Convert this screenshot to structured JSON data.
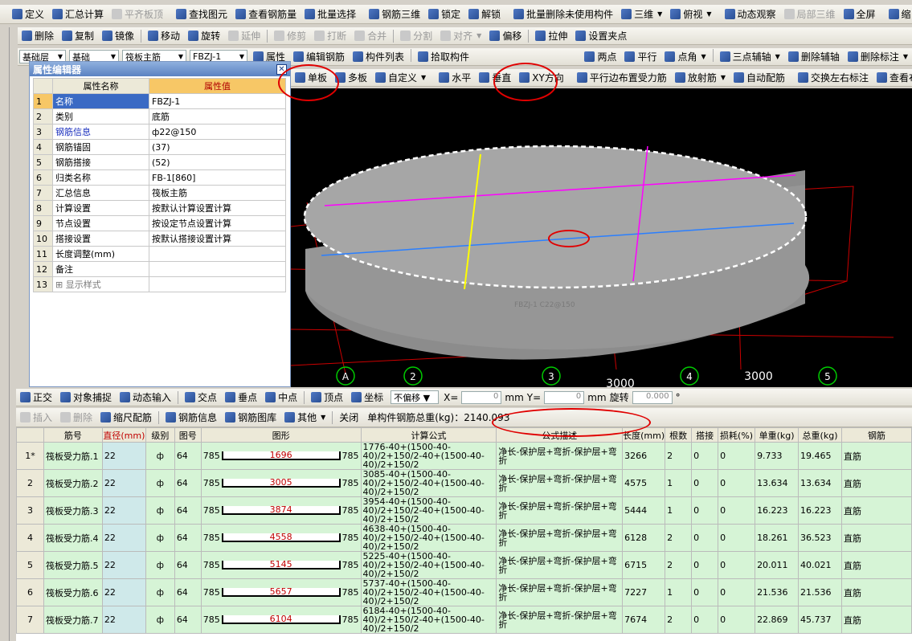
{
  "toolbar1": [
    {
      "label": "定义",
      "icon": "define-icon"
    },
    {
      "label": "汇总计算",
      "icon": "sigma-icon"
    },
    {
      "label": "平齐板顶",
      "icon": "align-icon",
      "disabled": true
    },
    {
      "label": "查找图元",
      "icon": "find-icon"
    },
    {
      "label": "查看钢筋量",
      "icon": "rebar-view-icon"
    },
    {
      "label": "批量选择",
      "icon": "batch-select-icon"
    },
    {
      "label": "钢筋三维",
      "icon": "rebar3d-icon"
    },
    {
      "label": "锁定",
      "icon": "lock-icon"
    },
    {
      "label": "解锁",
      "icon": "unlock-icon"
    },
    {
      "label": "批量删除未使用构件",
      "icon": "batch-delete-icon"
    },
    {
      "label": "三维",
      "icon": "cube-icon",
      "dropdown": true
    },
    {
      "label": "俯视",
      "icon": "top-view-icon",
      "dropdown": true
    },
    {
      "label": "动态观察",
      "icon": "orbit-icon"
    },
    {
      "label": "局部三维",
      "icon": "local3d-icon",
      "disabled": true
    },
    {
      "label": "全屏",
      "icon": "fullscreen-icon"
    },
    {
      "label": "缩",
      "icon": "zoom-icon"
    }
  ],
  "toolbar2": [
    {
      "label": "删除",
      "icon": "delete-icon"
    },
    {
      "label": "复制",
      "icon": "copy-icon"
    },
    {
      "label": "镜像",
      "icon": "mirror-icon"
    },
    {
      "label": "移动",
      "icon": "move-icon"
    },
    {
      "label": "旋转",
      "icon": "rotate-icon"
    },
    {
      "label": "延伸",
      "icon": "extend-icon",
      "disabled": true
    },
    {
      "label": "修剪",
      "icon": "trim-icon",
      "disabled": true
    },
    {
      "label": "打断",
      "icon": "break-icon",
      "disabled": true
    },
    {
      "label": "合并",
      "icon": "merge-icon",
      "disabled": true
    },
    {
      "label": "分割",
      "icon": "split-icon",
      "disabled": true
    },
    {
      "label": "对齐",
      "icon": "align2-icon",
      "disabled": true,
      "dropdown": true
    },
    {
      "label": "偏移",
      "icon": "offset-icon"
    },
    {
      "label": "拉伸",
      "icon": "stretch-icon"
    },
    {
      "label": "设置夹点",
      "icon": "grip-icon"
    }
  ],
  "toolbar3": {
    "combo1": "基础层",
    "combo2": "基础",
    "combo3": "筏板主筋",
    "combo4": "FBZJ-1",
    "buttons": [
      {
        "label": "属性",
        "icon": "property-icon"
      },
      {
        "label": "编辑钢筋",
        "icon": "edit-rebar-icon"
      },
      {
        "label": "构件列表",
        "icon": "list-icon"
      },
      {
        "label": "拾取构件",
        "icon": "pick-icon"
      }
    ],
    "right": [
      {
        "label": "两点",
        "icon": "two-point-icon"
      },
      {
        "label": "平行",
        "icon": "parallel-icon"
      },
      {
        "label": "点角",
        "icon": "point-angle-icon",
        "dropdown": true
      },
      {
        "label": "三点辅轴",
        "icon": "three-point-axis-icon",
        "dropdown": true
      },
      {
        "label": "删除辅轴",
        "icon": "delete-axis-icon"
      },
      {
        "label": "删除标注",
        "icon": "delete-dim-icon",
        "dropdown": true
      }
    ]
  },
  "toolbar4": [
    {
      "label": "单板",
      "icon": "single-slab-icon"
    },
    {
      "label": "多板",
      "icon": "multi-slab-icon"
    },
    {
      "label": "自定义",
      "icon": "custom-icon",
      "dropdown": true
    },
    {
      "label": "水平",
      "icon": "horizontal-icon"
    },
    {
      "label": "垂直",
      "icon": "vertical-icon"
    },
    {
      "label": "XY方向",
      "icon": "xy-direction-icon"
    },
    {
      "label": "平行边布置受力筋",
      "icon": "parallel-edge-icon"
    },
    {
      "label": "放射筋",
      "icon": "radial-icon",
      "dropdown": true
    },
    {
      "label": "自动配筋",
      "icon": "auto-rebar-icon"
    },
    {
      "label": "交换左右标注",
      "icon": "swap-icon"
    },
    {
      "label": "查看布筋",
      "icon": "view-rebar-icon",
      "dropdown": true
    }
  ],
  "property_editor": {
    "title": "属性编辑器",
    "col_name": "属性名称",
    "col_value": "属性值",
    "rows": [
      {
        "n": "1",
        "name": "名称",
        "value": "FBZJ-1",
        "link": true
      },
      {
        "n": "2",
        "name": "类别",
        "value": "底筋"
      },
      {
        "n": "3",
        "name": "钢筋信息",
        "value": "ф22@150",
        "link": true
      },
      {
        "n": "4",
        "name": "钢筋锚固",
        "value": "(37)"
      },
      {
        "n": "5",
        "name": "钢筋搭接",
        "value": "(52)"
      },
      {
        "n": "6",
        "name": "归类名称",
        "value": "FB-1[860]"
      },
      {
        "n": "7",
        "name": "汇总信息",
        "value": "筏板主筋"
      },
      {
        "n": "8",
        "name": "计算设置",
        "value": "按默认计算设置计算"
      },
      {
        "n": "9",
        "name": "节点设置",
        "value": "按设定节点设置计算"
      },
      {
        "n": "10",
        "name": "搭接设置",
        "value": "按默认搭接设置计算"
      },
      {
        "n": "11",
        "name": "长度调整(mm)",
        "value": ""
      },
      {
        "n": "12",
        "name": "备注",
        "value": ""
      },
      {
        "n": "13",
        "name": "显示样式",
        "value": "",
        "expand": true
      }
    ]
  },
  "viewport": {
    "axis_labels": [
      "A",
      "2",
      "3",
      "4",
      "5"
    ],
    "dims": [
      "3000",
      "3000"
    ],
    "ghost_label": "FBZJ-1 C22@150"
  },
  "snap_bar": {
    "buttons": [
      {
        "label": "正交",
        "icon": "ortho-icon"
      },
      {
        "label": "对象捕捉",
        "icon": "snap-icon"
      },
      {
        "label": "动态输入",
        "icon": "dynamic-input-icon"
      },
      {
        "label": "交点",
        "icon": "intersection-icon"
      },
      {
        "label": "垂点",
        "icon": "perpendicular-icon"
      },
      {
        "label": "中点",
        "icon": "midpoint-icon"
      },
      {
        "label": "顶点",
        "icon": "vertex-icon"
      },
      {
        "label": "坐标",
        "icon": "coordinate-icon"
      }
    ],
    "offset_mode": "不偏移",
    "x_label": "X=",
    "x_value": "0",
    "y_label": "Y=",
    "y_value": "0",
    "unit": "mm",
    "rotate_label": "旋转",
    "rotate_value": "0.000",
    "deg": "°"
  },
  "rebar_toolbar": {
    "buttons": [
      {
        "label": "插入",
        "icon": "insert-icon",
        "disabled": true
      },
      {
        "label": "删除",
        "icon": "delete-row-icon",
        "disabled": true
      },
      {
        "label": "缩尺配筋",
        "icon": "scale-rebar-icon"
      },
      {
        "label": "钢筋信息",
        "icon": "rebar-info-icon"
      },
      {
        "label": "钢筋图库",
        "icon": "rebar-library-icon"
      },
      {
        "label": "其他",
        "icon": "other-icon",
        "dropdown": true
      },
      {
        "label": "关闭",
        "icon": ""
      }
    ],
    "total_weight": "单构件钢筋总重(kg)：2140.093"
  },
  "rebar_table": {
    "headers": [
      "",
      "筋号",
      "直径(mm)",
      "级别",
      "图号",
      "图形",
      "计算公式",
      "公式描述",
      "长度(mm)",
      "根数",
      "搭接",
      "损耗(%)",
      "单重(kg)",
      "总重(kg)",
      "钢筋"
    ],
    "rows": [
      {
        "n": "1*",
        "name": "筏板受力筋.1",
        "dia": "22",
        "grade": "ф",
        "fig": "64",
        "l": "785",
        "mid": "1696",
        "r": "785",
        "formula": "1776-40+(1500-40-40)/2+150/2-40+(1500-40-40)/2+150/2",
        "desc": "净长-保护层+弯折-保护层+弯折",
        "len": "3266",
        "count": "2",
        "lap": "0",
        "loss": "0",
        "uw": "9.733",
        "tw": "19.465",
        "type": "直筋"
      },
      {
        "n": "2",
        "name": "筏板受力筋.2",
        "dia": "22",
        "grade": "ф",
        "fig": "64",
        "l": "785",
        "mid": "3005",
        "r": "785",
        "formula": "3085-40+(1500-40-40)/2+150/2-40+(1500-40-40)/2+150/2",
        "desc": "净长-保护层+弯折-保护层+弯折",
        "len": "4575",
        "count": "1",
        "lap": "0",
        "loss": "0",
        "uw": "13.634",
        "tw": "13.634",
        "type": "直筋"
      },
      {
        "n": "3",
        "name": "筏板受力筋.3",
        "dia": "22",
        "grade": "ф",
        "fig": "64",
        "l": "785",
        "mid": "3874",
        "r": "785",
        "formula": "3954-40+(1500-40-40)/2+150/2-40+(1500-40-40)/2+150/2",
        "desc": "净长-保护层+弯折-保护层+弯折",
        "len": "5444",
        "count": "1",
        "lap": "0",
        "loss": "0",
        "uw": "16.223",
        "tw": "16.223",
        "type": "直筋"
      },
      {
        "n": "4",
        "name": "筏板受力筋.4",
        "dia": "22",
        "grade": "ф",
        "fig": "64",
        "l": "785",
        "mid": "4558",
        "r": "785",
        "formula": "4638-40+(1500-40-40)/2+150/2-40+(1500-40-40)/2+150/2",
        "desc": "净长-保护层+弯折-保护层+弯折",
        "len": "6128",
        "count": "2",
        "lap": "0",
        "loss": "0",
        "uw": "18.261",
        "tw": "36.523",
        "type": "直筋"
      },
      {
        "n": "5",
        "name": "筏板受力筋.5",
        "dia": "22",
        "grade": "ф",
        "fig": "64",
        "l": "785",
        "mid": "5145",
        "r": "785",
        "formula": "5225-40+(1500-40-40)/2+150/2-40+(1500-40-40)/2+150/2",
        "desc": "净长-保护层+弯折-保护层+弯折",
        "len": "6715",
        "count": "2",
        "lap": "0",
        "loss": "0",
        "uw": "20.011",
        "tw": "40.021",
        "type": "直筋"
      },
      {
        "n": "6",
        "name": "筏板受力筋.6",
        "dia": "22",
        "grade": "ф",
        "fig": "64",
        "l": "785",
        "mid": "5657",
        "r": "785",
        "formula": "5737-40+(1500-40-40)/2+150/2-40+(1500-40-40)/2+150/2",
        "desc": "净长-保护层+弯折-保护层+弯折",
        "len": "7227",
        "count": "1",
        "lap": "0",
        "loss": "0",
        "uw": "21.536",
        "tw": "21.536",
        "type": "直筋"
      },
      {
        "n": "7",
        "name": "筏板受力筋.7",
        "dia": "22",
        "grade": "ф",
        "fig": "64",
        "l": "785",
        "mid": "6104",
        "r": "785",
        "formula": "6184-40+(1500-40-40)/2+150/2-40+(1500-40-40)/2+150/2",
        "desc": "净长-保护层+弯折-保护层+弯折",
        "len": "7674",
        "count": "2",
        "lap": "0",
        "loss": "0",
        "uw": "22.869",
        "tw": "45.737",
        "type": "直筋"
      }
    ]
  },
  "colors": {
    "annotation": "#e00000",
    "slab": "#a6a6a6",
    "magenta": "#ff00ff",
    "yellow": "#ffff00",
    "blue": "#2a7fff"
  }
}
